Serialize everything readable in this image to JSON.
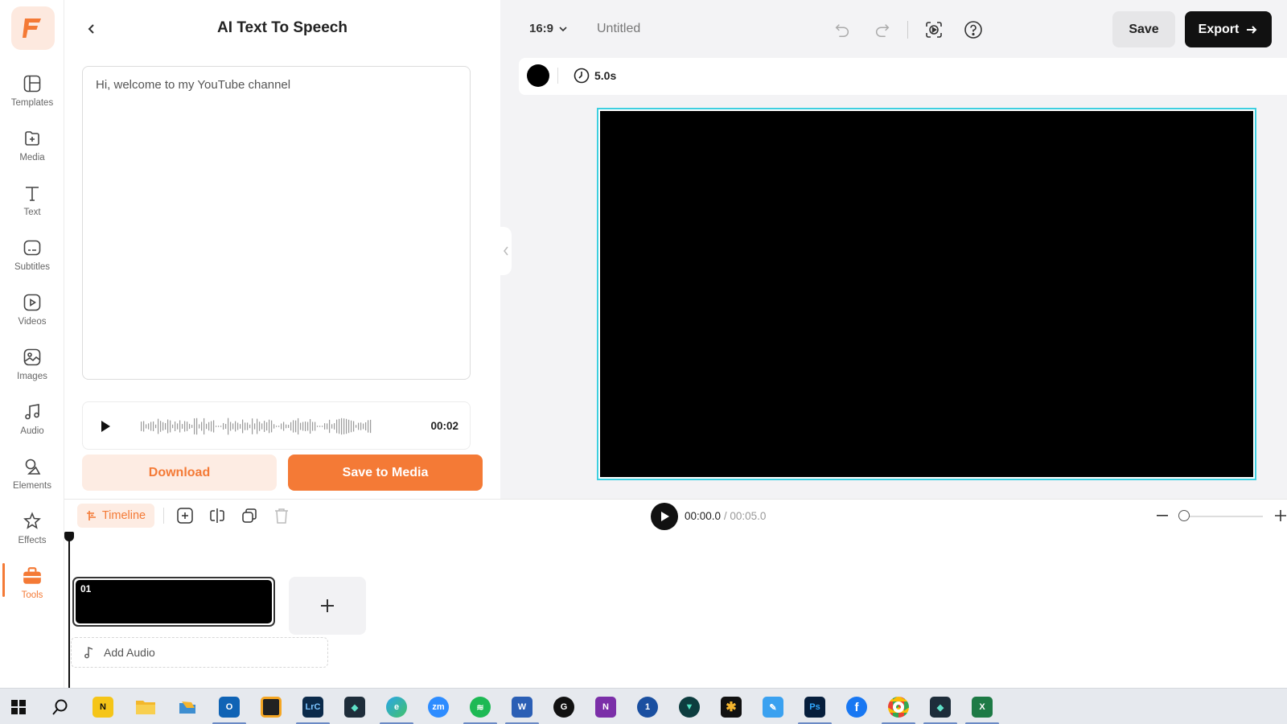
{
  "sidebar": {
    "items": [
      {
        "label": "Templates",
        "icon": "templates-icon"
      },
      {
        "label": "Media",
        "icon": "media-icon"
      },
      {
        "label": "Text",
        "icon": "text-icon"
      },
      {
        "label": "Subtitles",
        "icon": "subtitles-icon"
      },
      {
        "label": "Videos",
        "icon": "videos-icon"
      },
      {
        "label": "Images",
        "icon": "images-icon"
      },
      {
        "label": "Audio",
        "icon": "audio-icon"
      },
      {
        "label": "Elements",
        "icon": "elements-icon"
      },
      {
        "label": "Effects",
        "icon": "effects-icon"
      },
      {
        "label": "Tools",
        "icon": "tools-icon",
        "active": true
      }
    ]
  },
  "panel": {
    "title": "AI Text To Speech",
    "text_value": "Hi, welcome to my YouTube channel",
    "audio_duration": "00:02",
    "download_label": "Download",
    "save_to_media_label": "Save to Media"
  },
  "topbar": {
    "aspect_ratio": "16:9",
    "project_title": "Untitled",
    "save_label": "Save",
    "export_label": "Export"
  },
  "canvas": {
    "background_color": "#000000",
    "duration": "5.0s"
  },
  "timeline": {
    "tab_label": "Timeline",
    "current_time": "00:00.0",
    "total_time": "/ 00:05.0",
    "clips": [
      {
        "number": "01"
      }
    ],
    "add_audio_label": "Add Audio"
  },
  "taskbar": {
    "apps": [
      "start",
      "search",
      "norton",
      "file-explorer",
      "onedrive",
      "outlook",
      "snip",
      "lightroom-classic",
      "filmora",
      "edge",
      "zoom",
      "spotify",
      "word",
      "grammarly",
      "onenote",
      "1password",
      "vpn",
      "sunburst",
      "pen",
      "photoshop",
      "facebook",
      "chrome",
      "filmora-alt",
      "excel"
    ]
  },
  "colors": {
    "accent": "#f47a36",
    "selection": "#3ecfe0"
  }
}
